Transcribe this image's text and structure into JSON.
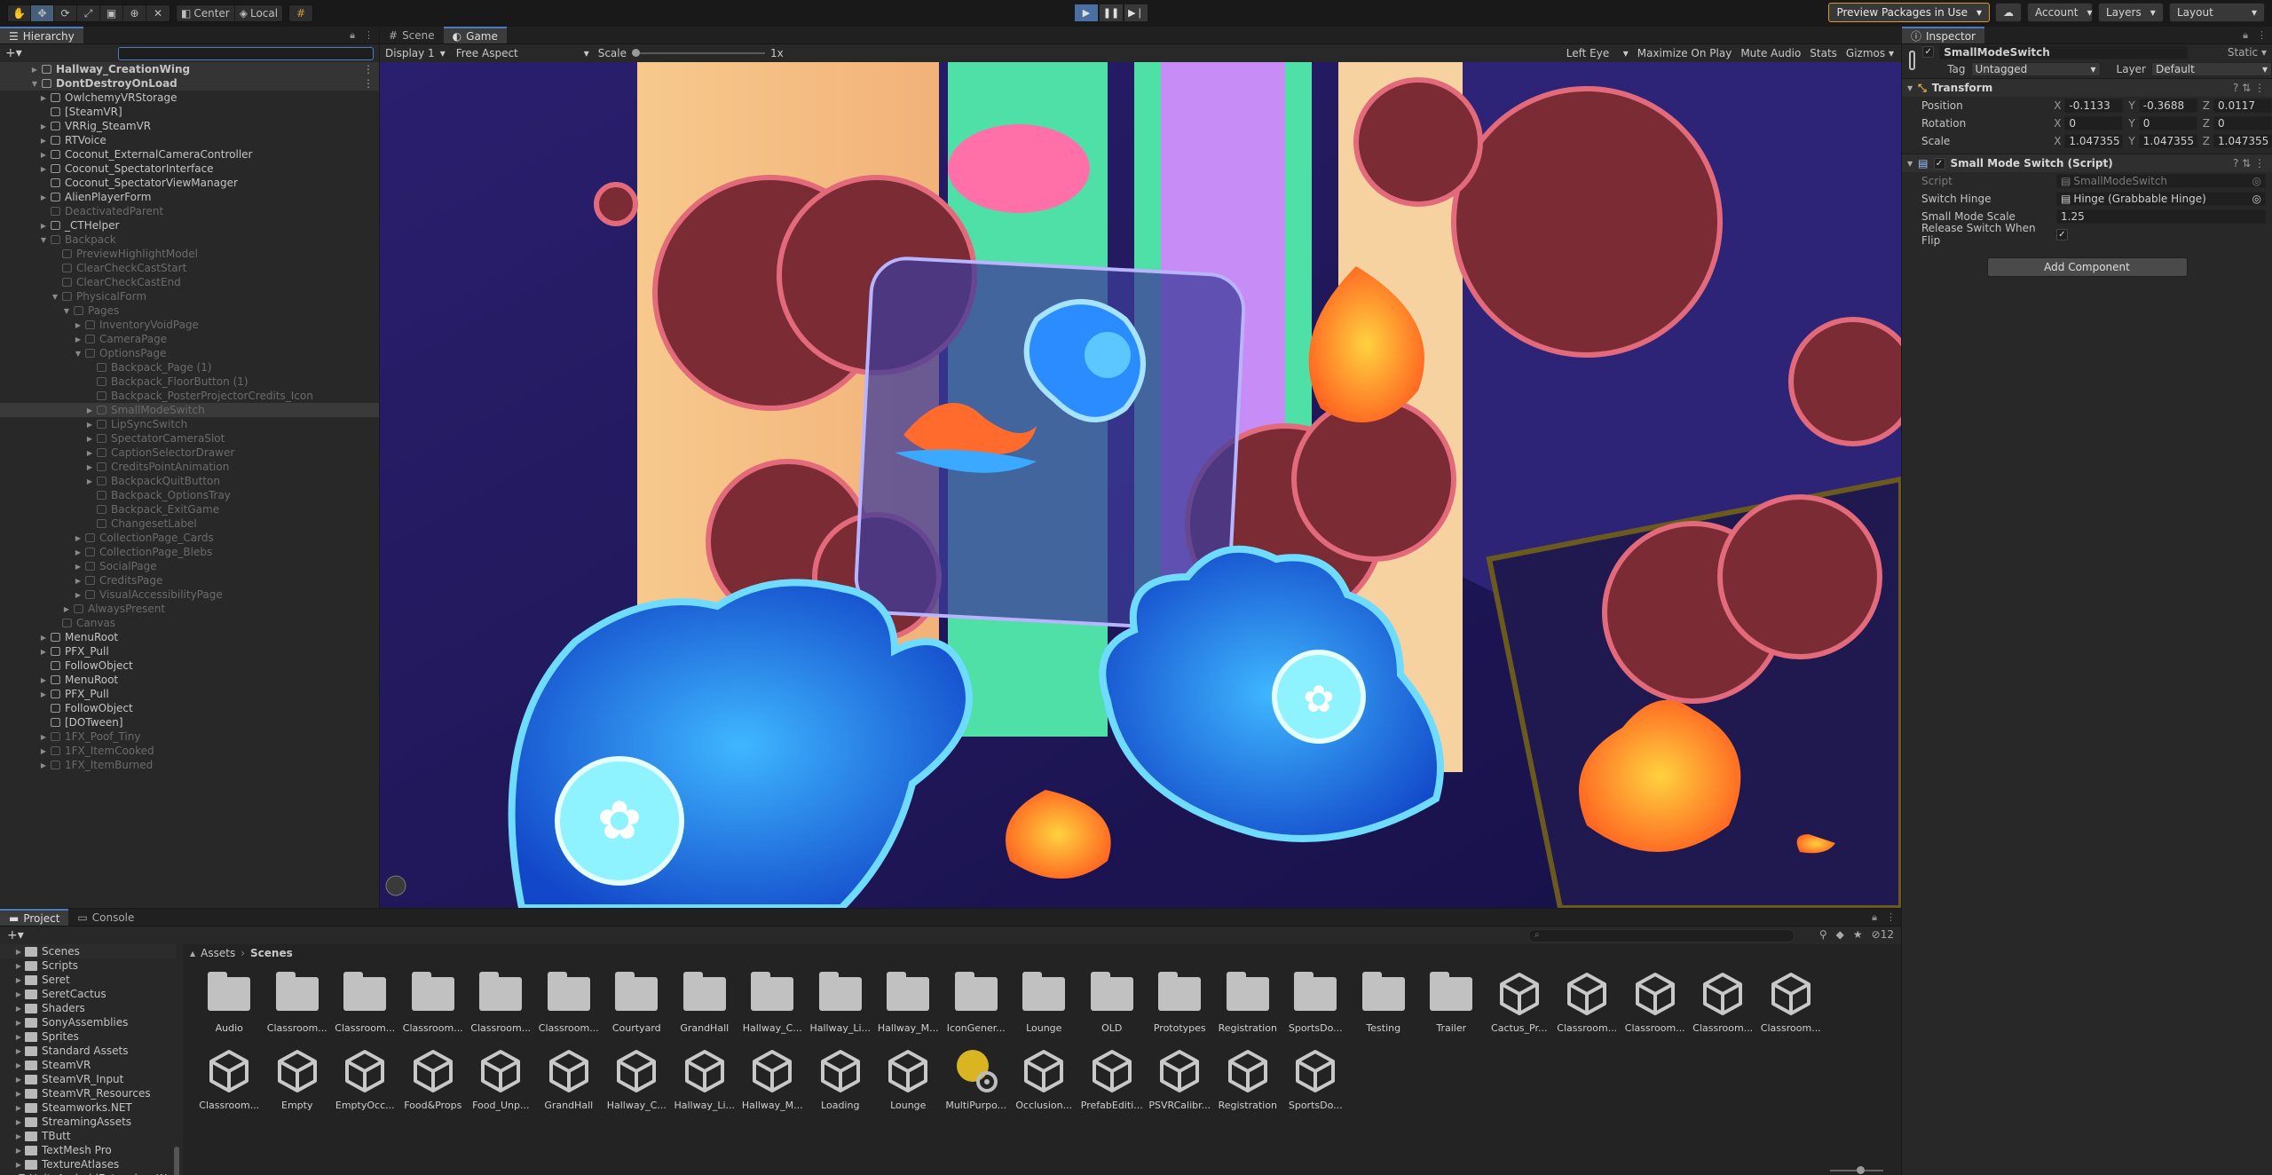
{
  "toolbar": {
    "pivot": "Center",
    "space": "Local",
    "preview_packages": "Preview Packages in Use",
    "account": "Account",
    "layers": "Layers",
    "layout": "Layout"
  },
  "hierarchy": {
    "tab": "Hierarchy",
    "rows": [
      {
        "label": "Hallway_CreationWing",
        "indent": 0,
        "arrow": "▶",
        "type": "scene"
      },
      {
        "label": "DontDestroyOnLoad",
        "indent": 0,
        "arrow": "▼",
        "type": "scene"
      },
      {
        "label": "OwlchemyVRStorage",
        "indent": 1,
        "arrow": "▶"
      },
      {
        "label": "[SteamVR]",
        "indent": 1,
        "arrow": ""
      },
      {
        "label": "VRRig_SteamVR",
        "indent": 1,
        "arrow": "▶"
      },
      {
        "label": "RTVoice",
        "indent": 1,
        "arrow": "▶"
      },
      {
        "label": "Coconut_ExternalCameraController",
        "indent": 1,
        "arrow": "▶"
      },
      {
        "label": "Coconut_SpectatorInterface",
        "indent": 1,
        "arrow": "▶"
      },
      {
        "label": "Coconut_SpectatorViewManager",
        "indent": 1,
        "arrow": ""
      },
      {
        "label": "AlienPlayerForm",
        "indent": 1,
        "arrow": "▶"
      },
      {
        "label": "DeactivatedParent",
        "indent": 1,
        "arrow": "",
        "dim": true
      },
      {
        "label": "_CTHelper",
        "indent": 1,
        "arrow": "▶"
      },
      {
        "label": "Backpack",
        "indent": 1,
        "arrow": "▼",
        "dim": true
      },
      {
        "label": "PreviewHighlightModel",
        "indent": 2,
        "arrow": "",
        "dim": true
      },
      {
        "label": "ClearCheckCastStart",
        "indent": 2,
        "arrow": "",
        "dim": true
      },
      {
        "label": "ClearCheckCastEnd",
        "indent": 2,
        "arrow": "",
        "dim": true
      },
      {
        "label": "PhysicalForm",
        "indent": 2,
        "arrow": "▼",
        "dim": true
      },
      {
        "label": "Pages",
        "indent": 3,
        "arrow": "▼",
        "dim": true
      },
      {
        "label": "InventoryVoidPage",
        "indent": 4,
        "arrow": "▶",
        "dim": true
      },
      {
        "label": "CameraPage",
        "indent": 4,
        "arrow": "▶",
        "dim": true
      },
      {
        "label": "OptionsPage",
        "indent": 4,
        "arrow": "▼",
        "dim": true
      },
      {
        "label": "Backpack_Page (1)",
        "indent": 5,
        "arrow": "",
        "dim": true
      },
      {
        "label": "Backpack_FloorButton (1)",
        "indent": 5,
        "arrow": "",
        "dim": true
      },
      {
        "label": "Backpack_PosterProjectorCredits_Icon",
        "indent": 5,
        "arrow": "",
        "dim": true
      },
      {
        "label": "SmallModeSwitch",
        "indent": 5,
        "arrow": "▶",
        "dim": true,
        "selected": true
      },
      {
        "label": "LipSyncSwitch",
        "indent": 5,
        "arrow": "▶",
        "dim": true
      },
      {
        "label": "SpectatorCameraSlot",
        "indent": 5,
        "arrow": "▶",
        "dim": true
      },
      {
        "label": "CaptionSelectorDrawer",
        "indent": 5,
        "arrow": "▶",
        "dim": true
      },
      {
        "label": "CreditsPointAnimation",
        "indent": 5,
        "arrow": "▶",
        "dim": true
      },
      {
        "label": "BackpackQuitButton",
        "indent": 5,
        "arrow": "▶",
        "dim": true
      },
      {
        "label": "Backpack_OptionsTray",
        "indent": 5,
        "arrow": "",
        "dim": true
      },
      {
        "label": "Backpack_ExitGame",
        "indent": 5,
        "arrow": "",
        "dim": true
      },
      {
        "label": "ChangesetLabel",
        "indent": 5,
        "arrow": "",
        "dim": true
      },
      {
        "label": "CollectionPage_Cards",
        "indent": 4,
        "arrow": "▶",
        "dim": true
      },
      {
        "label": "CollectionPage_Blebs",
        "indent": 4,
        "arrow": "▶",
        "dim": true
      },
      {
        "label": "SocialPage",
        "indent": 4,
        "arrow": "▶",
        "dim": true
      },
      {
        "label": "CreditsPage",
        "indent": 4,
        "arrow": "▶",
        "dim": true
      },
      {
        "label": "VisualAccessibilityPage",
        "indent": 4,
        "arrow": "▶",
        "dim": true
      },
      {
        "label": "AlwaysPresent",
        "indent": 3,
        "arrow": "▶",
        "dim": true
      },
      {
        "label": "Canvas",
        "indent": 2,
        "arrow": "",
        "dim": true
      },
      {
        "label": "MenuRoot",
        "indent": 1,
        "arrow": "▶"
      },
      {
        "label": "PFX_Pull",
        "indent": 1,
        "arrow": "▶"
      },
      {
        "label": "FollowObject",
        "indent": 1,
        "arrow": ""
      },
      {
        "label": "MenuRoot",
        "indent": 1,
        "arrow": "▶"
      },
      {
        "label": "PFX_Pull",
        "indent": 1,
        "arrow": "▶"
      },
      {
        "label": "FollowObject",
        "indent": 1,
        "arrow": ""
      },
      {
        "label": "[DOTween]",
        "indent": 1,
        "arrow": ""
      },
      {
        "label": "1FX_Poof_Tiny",
        "indent": 1,
        "arrow": "▶",
        "dim": true
      },
      {
        "label": "1FX_ItemCooked",
        "indent": 1,
        "arrow": "▶",
        "dim": true
      },
      {
        "label": "1FX_ItemBurned",
        "indent": 1,
        "arrow": "▶",
        "dim": true
      }
    ]
  },
  "game": {
    "tabs": [
      "Scene",
      "Game"
    ],
    "display": "Display 1",
    "aspect": "Free Aspect",
    "scale_label": "Scale",
    "scale_value": "1x",
    "eye": "Left Eye",
    "maximize": "Maximize On Play",
    "mute": "Mute Audio",
    "stats": "Stats",
    "gizmos": "Gizmos"
  },
  "inspector": {
    "tab": "Inspector",
    "object_name": "SmallModeSwitch",
    "static_label": "Static",
    "tag_label": "Tag",
    "tag_value": "Untagged",
    "layer_label": "Layer",
    "layer_value": "Default",
    "transform": {
      "title": "Transform",
      "position_label": "Position",
      "rotation_label": "Rotation",
      "scale_label": "Scale",
      "position": [
        "-0.1133",
        "-0.3688",
        "0.0117"
      ],
      "rotation": [
        "0",
        "0",
        "0"
      ],
      "scale": [
        "1.047355",
        "1.047355",
        "1.047355"
      ]
    },
    "script_comp": {
      "title": "Small Mode Switch (Script)",
      "script_label": "Script",
      "script_value": "SmallModeSwitch",
      "hinge_label": "Switch Hinge",
      "hinge_value": "Hinge (Grabbable Hinge)",
      "scale_label": "Small Mode Scale",
      "scale_value": "1.25",
      "release_label": "Release Switch When Flip"
    },
    "add_component": "Add Component"
  },
  "project": {
    "tabs": [
      "Project",
      "Console"
    ],
    "count": "12",
    "tree": [
      "Scenes",
      "Scripts",
      "Seret",
      "SeretCactus",
      "Shaders",
      "SonyAssemblies",
      "Sprites",
      "Standard Assets",
      "SteamVR",
      "SteamVR_Input",
      "SteamVR_Resources",
      "Steamworks.NET",
      "StreamingAssets",
      "TButt",
      "TextMesh Pro",
      "TextureAtlases",
      "UnityAndroidExtensionsW..."
    ],
    "breadcrumb": [
      "Assets",
      "Scenes"
    ],
    "assets": [
      {
        "name": "Audio",
        "kind": "folder"
      },
      {
        "name": "Classroom...",
        "kind": "folder"
      },
      {
        "name": "Classroom...",
        "kind": "folder"
      },
      {
        "name": "Classroom...",
        "kind": "folder"
      },
      {
        "name": "Classroom...",
        "kind": "folder"
      },
      {
        "name": "Classroom...",
        "kind": "folder"
      },
      {
        "name": "Courtyard",
        "kind": "folder"
      },
      {
        "name": "GrandHall",
        "kind": "folder"
      },
      {
        "name": "Hallway_C...",
        "kind": "folder"
      },
      {
        "name": "Hallway_Li...",
        "kind": "folder"
      },
      {
        "name": "Hallway_M...",
        "kind": "folder"
      },
      {
        "name": "IconGener...",
        "kind": "folder"
      },
      {
        "name": "Lounge",
        "kind": "folder"
      },
      {
        "name": "OLD",
        "kind": "folder"
      },
      {
        "name": "Prototypes",
        "kind": "folder"
      },
      {
        "name": "Registration",
        "kind": "folder"
      },
      {
        "name": "SportsDo...",
        "kind": "folder"
      },
      {
        "name": "Testing",
        "kind": "folder"
      },
      {
        "name": "Trailer",
        "kind": "folder"
      },
      {
        "name": "Cactus_Pr...",
        "kind": "unity"
      },
      {
        "name": "Classroom...",
        "kind": "unity"
      },
      {
        "name": "Classroom...",
        "kind": "unity"
      },
      {
        "name": "Classroom...",
        "kind": "unity"
      },
      {
        "name": "Classroom...",
        "kind": "unity"
      },
      {
        "name": "Classroom...",
        "kind": "unity"
      },
      {
        "name": "Empty",
        "kind": "unity"
      },
      {
        "name": "EmptyOcc...",
        "kind": "unity"
      },
      {
        "name": "Food&Props",
        "kind": "unity"
      },
      {
        "name": "Food_Unp...",
        "kind": "unity"
      },
      {
        "name": "GrandHall",
        "kind": "unity"
      },
      {
        "name": "Hallway_C...",
        "kind": "unity"
      },
      {
        "name": "Hallway_Li...",
        "kind": "unity"
      },
      {
        "name": "Hallway_M...",
        "kind": "unity"
      },
      {
        "name": "Loading",
        "kind": "unity"
      },
      {
        "name": "Lounge",
        "kind": "unity"
      },
      {
        "name": "MultiPurpo...",
        "kind": "lighting"
      },
      {
        "name": "Occlusion...",
        "kind": "unity"
      },
      {
        "name": "PrefabEditi...",
        "kind": "unity"
      },
      {
        "name": "PSVRCalibr...",
        "kind": "unity"
      },
      {
        "name": "Registration",
        "kind": "unity"
      },
      {
        "name": "SportsDo...",
        "kind": "unity"
      }
    ]
  }
}
